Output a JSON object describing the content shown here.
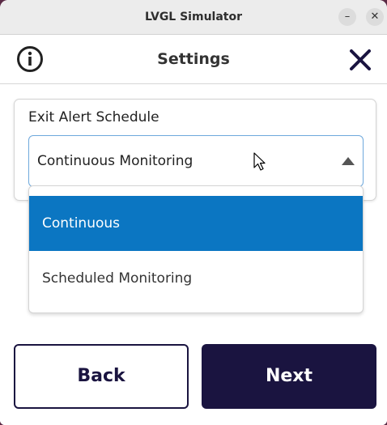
{
  "window": {
    "title": "LVGL Simulator",
    "minimize": "–",
    "close": "✕"
  },
  "header": {
    "title": "Settings",
    "info_icon": "info-circle-icon",
    "close_icon": "close-x-icon"
  },
  "card": {
    "label": "Exit Alert Schedule",
    "selected_value": "Continuous Monitoring"
  },
  "dropdown": {
    "options": [
      "Continuous",
      "Scheduled Monitoring"
    ],
    "highlighted_index": 0
  },
  "buttons": {
    "back": "Back",
    "next": "Next"
  },
  "colors": {
    "accent": "#0b76c2",
    "primary_dark": "#1a1440",
    "select_border": "#6ea8dc"
  }
}
